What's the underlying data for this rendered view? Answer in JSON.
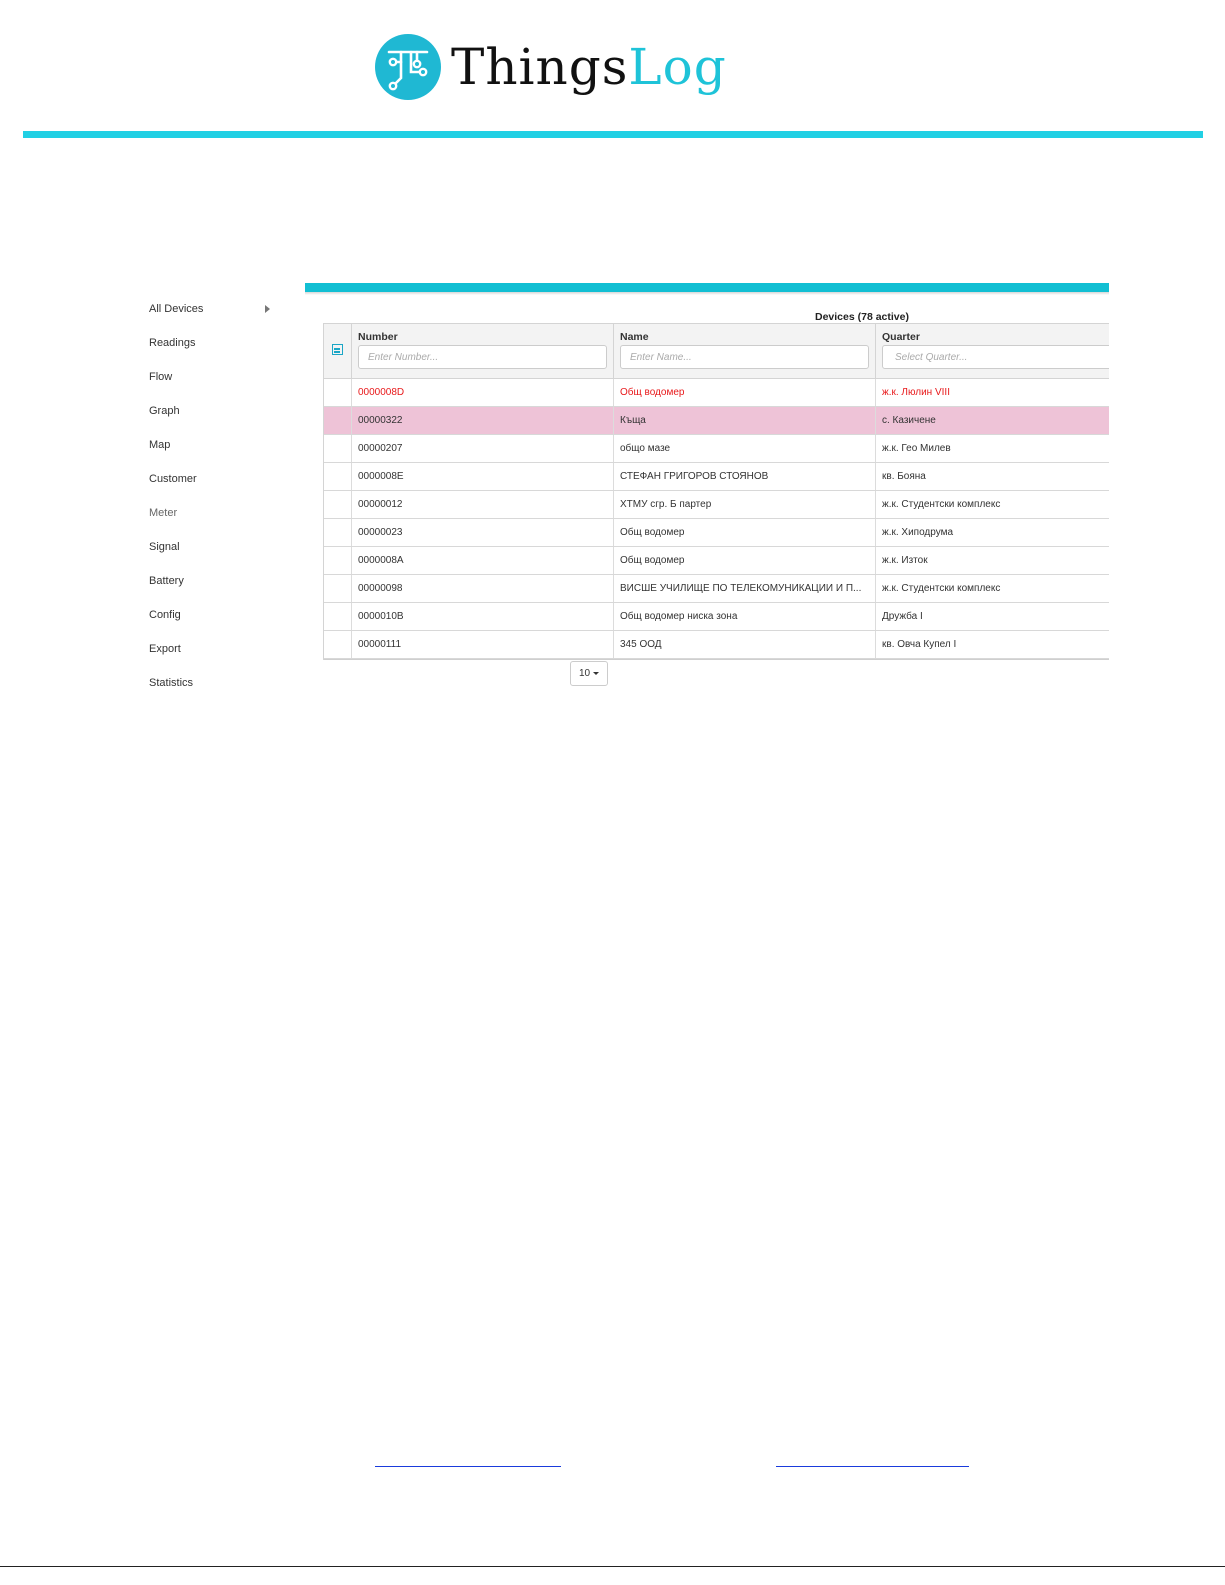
{
  "brand": {
    "name_part1": "Things",
    "name_part2": "Log",
    "colors": {
      "accent": "#21d0e4",
      "panel_bar": "#12bfd3",
      "selected_row": "#eec3d7",
      "alert_text": "#e8191b"
    }
  },
  "sidebar": {
    "items": [
      {
        "label": "All Devices",
        "has_submenu": true
      },
      {
        "label": "Readings"
      },
      {
        "label": "Flow"
      },
      {
        "label": "Graph"
      },
      {
        "label": "Map"
      },
      {
        "label": "Customer"
      },
      {
        "label": "Meter"
      },
      {
        "label": "Signal"
      },
      {
        "label": "Battery"
      },
      {
        "label": "Config"
      },
      {
        "label": "Export"
      },
      {
        "label": "Statistics"
      }
    ]
  },
  "grid": {
    "title": "Devices (78 active)",
    "menu_icon": "grid-menu-icon",
    "columns": [
      {
        "label": "Number",
        "placeholder": "Enter Number..."
      },
      {
        "label": "Name",
        "placeholder": "Enter Name..."
      },
      {
        "label": "Quarter",
        "placeholder": "Select Quarter..."
      }
    ],
    "rows": [
      {
        "number": "0000008D",
        "name": "Общ водомер",
        "quarter": "ж.к. Люлин VIII",
        "state": "alert"
      },
      {
        "number": "00000322",
        "name": "Къща",
        "quarter": "с. Казичене",
        "state": "selected"
      },
      {
        "number": "00000207",
        "name": "общо мазе",
        "quarter": "ж.к. Гео Милев",
        "state": ""
      },
      {
        "number": "0000008E",
        "name": "СТЕФАН ГРИГОРОВ СТОЯНОВ",
        "quarter": "кв. Бояна",
        "state": ""
      },
      {
        "number": "00000012",
        "name": "ХТМУ сгр. Б партер",
        "quarter": "ж.к. Студентски комплекс",
        "state": ""
      },
      {
        "number": "00000023",
        "name": "Общ водомер",
        "quarter": "ж.к. Хиподрума",
        "state": ""
      },
      {
        "number": "0000008A",
        "name": "Общ водомер",
        "quarter": "ж.к. Изток",
        "state": ""
      },
      {
        "number": "00000098",
        "name": "ВИСШЕ УЧИЛИЩЕ ПО ТЕЛЕКОМУНИКАЦИИ И П...",
        "quarter": "ж.к. Студентски комплекс",
        "state": ""
      },
      {
        "number": "0000010B",
        "name": "Общ водомер ниска зона",
        "quarter": "Дружба I",
        "state": ""
      },
      {
        "number": "00000111",
        "name": "345 ООД",
        "quarter": "кв. Овча Купел I",
        "state": ""
      }
    ],
    "page_size": "10"
  }
}
